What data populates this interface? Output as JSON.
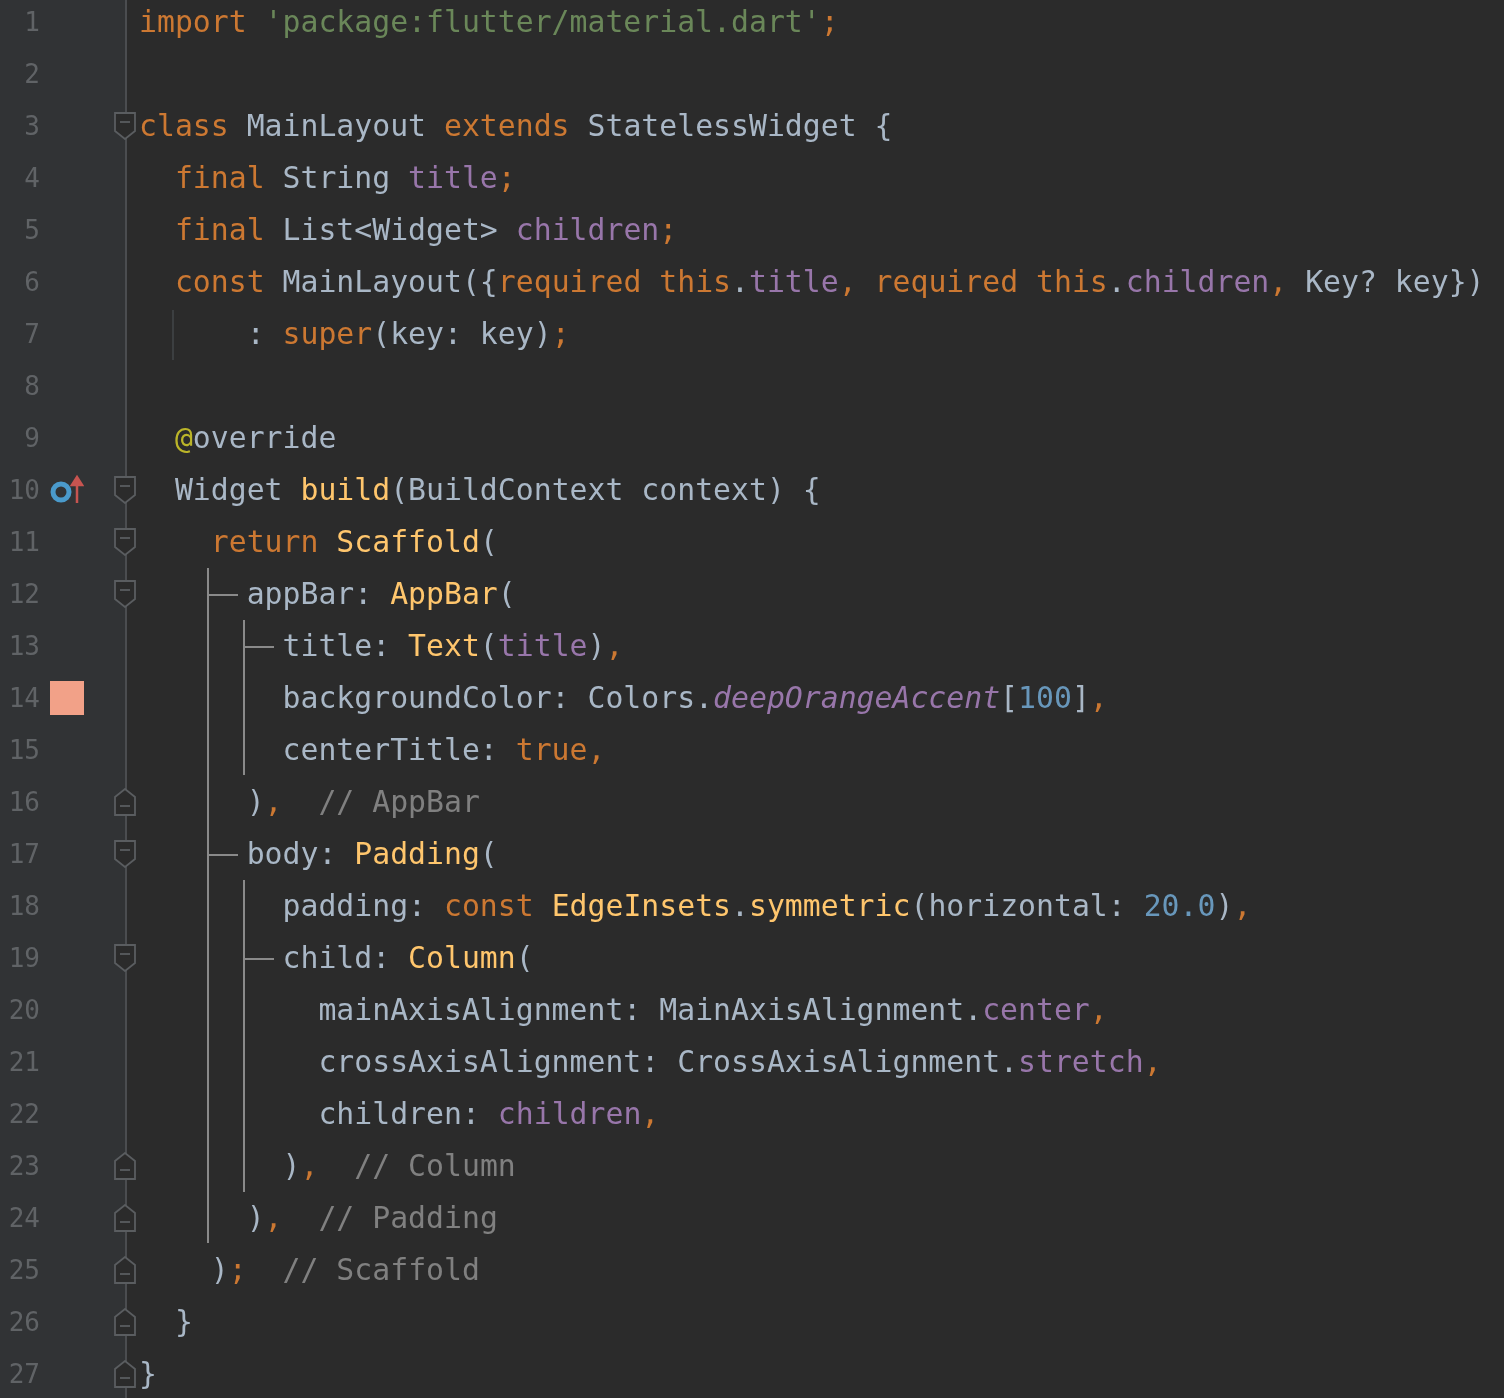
{
  "editor": {
    "lines": [
      {
        "number": "1",
        "fold_start": false,
        "fold_end": false,
        "tokens": [
          {
            "kind": "keyword",
            "text": "import"
          },
          {
            "kind": "string",
            "text": " 'package:flutter/material.dart'"
          },
          {
            "kind": "punct",
            "text": ";"
          }
        ]
      },
      {
        "number": "2",
        "fold_start": false,
        "fold_end": false
      },
      {
        "number": "3",
        "fold_start": true,
        "fold_end": false,
        "tokens": [
          {
            "kind": "keyword",
            "text": "class"
          },
          {
            "kind": "plain",
            "text": " MainLayout "
          },
          {
            "kind": "keyword",
            "text": "extends"
          },
          {
            "kind": "plain",
            "text": " StatelessWidget {"
          }
        ]
      },
      {
        "number": "4",
        "fold_start": false,
        "fold_end": false,
        "tokens": [
          {
            "kind": "keyword",
            "text": "  final"
          },
          {
            "kind": "plain",
            "text": " String "
          },
          {
            "kind": "field",
            "text": "title"
          },
          {
            "kind": "punct",
            "text": ";"
          }
        ]
      },
      {
        "number": "5",
        "fold_start": false,
        "fold_end": false,
        "tokens": [
          {
            "kind": "keyword",
            "text": "  final"
          },
          {
            "kind": "plain",
            "text": " List<Widget> "
          },
          {
            "kind": "field",
            "text": "children"
          },
          {
            "kind": "punct",
            "text": ";"
          }
        ]
      },
      {
        "number": "6",
        "fold_start": false,
        "fold_end": false,
        "tokens": [
          {
            "kind": "keyword",
            "text": "  const"
          },
          {
            "kind": "plain",
            "text": " MainLayout({"
          },
          {
            "kind": "keyword",
            "text": "required this"
          },
          {
            "kind": "plain",
            "text": "."
          },
          {
            "kind": "field",
            "text": "title"
          },
          {
            "kind": "punct",
            "text": ","
          },
          {
            "kind": "keyword",
            "text": " required this"
          },
          {
            "kind": "plain",
            "text": "."
          },
          {
            "kind": "field",
            "text": "children"
          },
          {
            "kind": "punct",
            "text": ","
          },
          {
            "kind": "plain",
            "text": " Key? key})"
          }
        ]
      },
      {
        "number": "7",
        "fold_start": false,
        "fold_end": false,
        "tokens": [
          {
            "kind": "plain",
            "text": "      : "
          },
          {
            "kind": "keyword",
            "text": "super"
          },
          {
            "kind": "plain",
            "text": "(key: key)"
          },
          {
            "kind": "punct",
            "text": ";"
          }
        ]
      },
      {
        "number": "8",
        "fold_start": false,
        "fold_end": false
      },
      {
        "number": "9",
        "fold_start": false,
        "fold_end": false,
        "tokens": [
          {
            "kind": "annotation",
            "text": "  @"
          },
          {
            "kind": "plain",
            "text": "override"
          }
        ]
      },
      {
        "number": "10",
        "fold_start": true,
        "fold_end": false,
        "gutter": {
          "kind": "override"
        },
        "tokens": [
          {
            "kind": "plain",
            "text": "  Widget "
          },
          {
            "kind": "function",
            "text": "build"
          },
          {
            "kind": "plain",
            "text": "(BuildContext context) {"
          }
        ]
      },
      {
        "number": "11",
        "fold_start": true,
        "fold_end": false,
        "tokens": [
          {
            "kind": "keyword",
            "text": "    return"
          },
          {
            "kind": "function",
            "text": " Scaffold"
          },
          {
            "kind": "plain",
            "text": "("
          }
        ]
      },
      {
        "number": "12",
        "fold_start": true,
        "fold_end": false,
        "tokens": [
          {
            "kind": "plain",
            "text": "      appBar: "
          },
          {
            "kind": "function",
            "text": "AppBar"
          },
          {
            "kind": "plain",
            "text": "("
          }
        ]
      },
      {
        "number": "13",
        "fold_start": false,
        "fold_end": false,
        "tokens": [
          {
            "kind": "plain",
            "text": "        title: "
          },
          {
            "kind": "function",
            "text": "Text"
          },
          {
            "kind": "plain",
            "text": "("
          },
          {
            "kind": "field",
            "text": "title"
          },
          {
            "kind": "plain",
            "text": ")"
          },
          {
            "kind": "punct",
            "text": ","
          }
        ]
      },
      {
        "number": "14",
        "fold_start": false,
        "fold_end": false,
        "gutter": {
          "kind": "swatch",
          "color": "#f2a188"
        },
        "tokens": [
          {
            "kind": "plain",
            "text": "        backgroundColor: Colors."
          },
          {
            "kind": "static",
            "text": "deepOrangeAccent"
          },
          {
            "kind": "plain",
            "text": "["
          },
          {
            "kind": "number",
            "text": "100"
          },
          {
            "kind": "plain",
            "text": "]"
          },
          {
            "kind": "punct",
            "text": ","
          }
        ]
      },
      {
        "number": "15",
        "fold_start": false,
        "fold_end": false,
        "tokens": [
          {
            "kind": "plain",
            "text": "        centerTitle: "
          },
          {
            "kind": "keyword",
            "text": "true"
          },
          {
            "kind": "punct",
            "text": ","
          }
        ]
      },
      {
        "number": "16",
        "fold_start": false,
        "fold_end": true,
        "tokens": [
          {
            "kind": "plain",
            "text": "      )"
          },
          {
            "kind": "punct",
            "text": ","
          },
          {
            "kind": "comment",
            "text": "  // AppBar"
          }
        ]
      },
      {
        "number": "17",
        "fold_start": true,
        "fold_end": false,
        "tokens": [
          {
            "kind": "plain",
            "text": "      body: "
          },
          {
            "kind": "function",
            "text": "Padding"
          },
          {
            "kind": "plain",
            "text": "("
          }
        ]
      },
      {
        "number": "18",
        "fold_start": false,
        "fold_end": false,
        "tokens": [
          {
            "kind": "plain",
            "text": "        padding: "
          },
          {
            "kind": "keyword",
            "text": "const"
          },
          {
            "kind": "function",
            "text": " EdgeInsets"
          },
          {
            "kind": "plain",
            "text": "."
          },
          {
            "kind": "function",
            "text": "symmetric"
          },
          {
            "kind": "plain",
            "text": "(horizontal: "
          },
          {
            "kind": "number",
            "text": "20.0"
          },
          {
            "kind": "plain",
            "text": ")"
          },
          {
            "kind": "punct",
            "text": ","
          }
        ]
      },
      {
        "number": "19",
        "fold_start": true,
        "fold_end": false,
        "tokens": [
          {
            "kind": "plain",
            "text": "        child: "
          },
          {
            "kind": "function",
            "text": "Column"
          },
          {
            "kind": "plain",
            "text": "("
          }
        ]
      },
      {
        "number": "20",
        "fold_start": false,
        "fold_end": false,
        "tokens": [
          {
            "kind": "plain",
            "text": "          mainAxisAlignment: MainAxisAlignment."
          },
          {
            "kind": "field",
            "text": "center"
          },
          {
            "kind": "punct",
            "text": ","
          }
        ]
      },
      {
        "number": "21",
        "fold_start": false,
        "fold_end": false,
        "tokens": [
          {
            "kind": "plain",
            "text": "          crossAxisAlignment: CrossAxisAlignment."
          },
          {
            "kind": "field",
            "text": "stretch"
          },
          {
            "kind": "punct",
            "text": ","
          }
        ]
      },
      {
        "number": "22",
        "fold_start": false,
        "fold_end": false,
        "tokens": [
          {
            "kind": "plain",
            "text": "          children: "
          },
          {
            "kind": "field",
            "text": "children"
          },
          {
            "kind": "punct",
            "text": ","
          }
        ]
      },
      {
        "number": "23",
        "fold_start": false,
        "fold_end": true,
        "tokens": [
          {
            "kind": "plain",
            "text": "        )"
          },
          {
            "kind": "punct",
            "text": ","
          },
          {
            "kind": "comment",
            "text": "  // Column"
          }
        ]
      },
      {
        "number": "24",
        "fold_start": false,
        "fold_end": true,
        "tokens": [
          {
            "kind": "plain",
            "text": "      )"
          },
          {
            "kind": "punct",
            "text": ","
          },
          {
            "kind": "comment",
            "text": "  // Padding"
          }
        ]
      },
      {
        "number": "25",
        "fold_start": false,
        "fold_end": true,
        "tokens": [
          {
            "kind": "plain",
            "text": "    )"
          },
          {
            "kind": "punct",
            "text": ";"
          },
          {
            "kind": "comment",
            "text": "  // Scaffold"
          }
        ]
      },
      {
        "number": "26",
        "fold_start": false,
        "fold_end": true,
        "tokens": [
          {
            "kind": "plain",
            "text": "  }"
          }
        ]
      },
      {
        "number": "27",
        "fold_start": false,
        "fold_end": true,
        "tokens": [
          {
            "kind": "plain",
            "text": "}"
          }
        ]
      }
    ]
  }
}
